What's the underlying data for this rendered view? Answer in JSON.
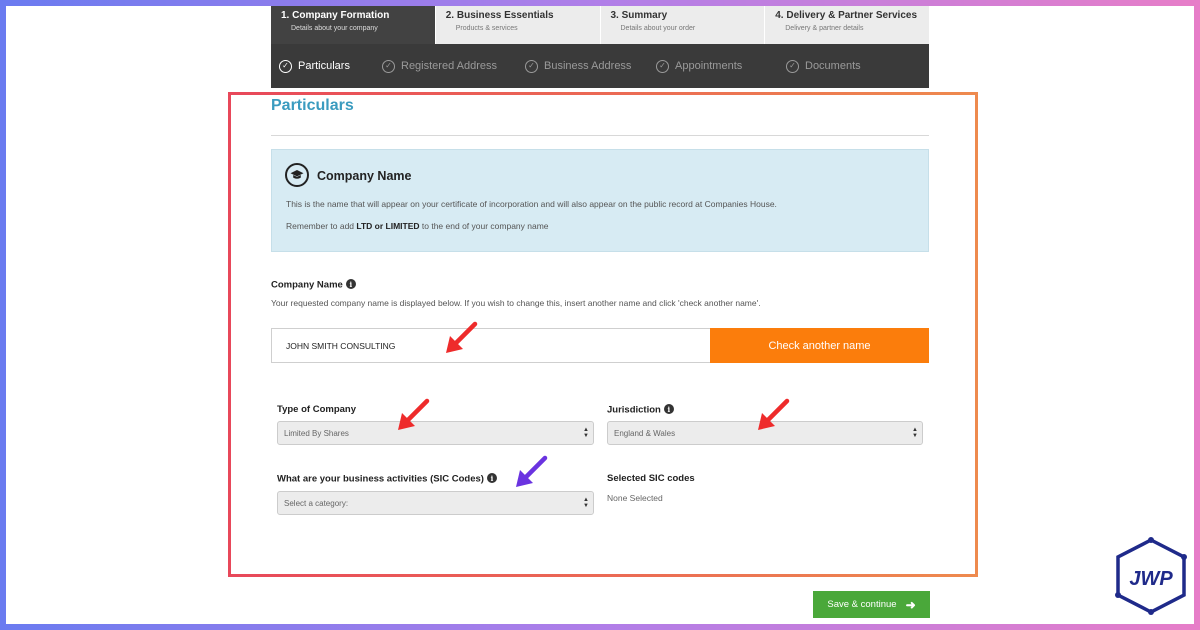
{
  "steps": [
    {
      "title": "1. Company Formation",
      "subtitle": "Details about your company"
    },
    {
      "title": "2. Business Essentials",
      "subtitle": "Products & services"
    },
    {
      "title": "3. Summary",
      "subtitle": "Details about your order"
    },
    {
      "title": "4. Delivery & Partner Services",
      "subtitle": "Delivery & partner details"
    }
  ],
  "substeps": [
    "Particulars",
    "Registered Address",
    "Business Address",
    "Appointments",
    "Documents"
  ],
  "section_title": "Particulars",
  "info": {
    "title": "Company Name",
    "text1": "This is the name that will appear on your certificate of incorporation and will also appear on the public record at Companies House.",
    "text2_prefix": "Remember to add ",
    "text2_bold": "LTD or LIMITED",
    "text2_suffix": " to the end of your company name"
  },
  "company_name": {
    "label": "Company Name",
    "help": "Your requested company name is displayed below. If you wish to change this, insert another name and click 'check another name'.",
    "value": "JOHN SMITH CONSULTING",
    "check_button": "Check another name"
  },
  "type_of_company": {
    "label": "Type of Company",
    "selected": "Limited By Shares"
  },
  "jurisdiction": {
    "label": "Jurisdiction",
    "selected": "England & Wales"
  },
  "sic": {
    "label": "What are your business activities (SIC Codes)",
    "placeholder": "Select a category:",
    "selected_label": "Selected SIC codes",
    "selected_value": "None Selected"
  },
  "save_button": "Save & continue",
  "logo_text": "JWP",
  "colors": {
    "accent_title": "#3a9bbf",
    "check_button": "#fb7d0c",
    "save_button": "#4aa83a",
    "header_active": "#424242",
    "annotation_red": "#ee2b2b",
    "annotation_purple": "#6a33e0",
    "logo_blue": "#1f2a8a"
  }
}
